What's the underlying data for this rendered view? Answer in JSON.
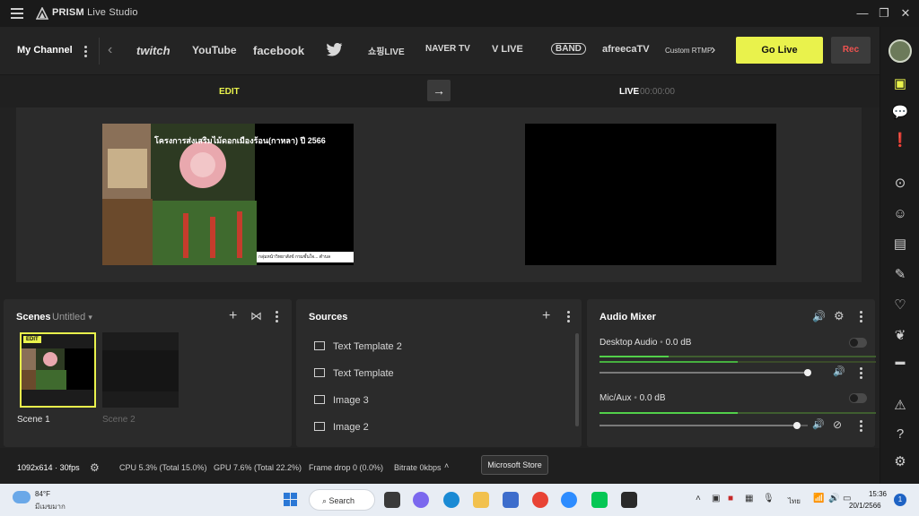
{
  "titlebar": {
    "app_name": "PRISM",
    "app_subtitle": "Live Studio",
    "minimize": "—",
    "restore": "❐",
    "close": "✕"
  },
  "channelbar": {
    "channel_label": "My Channel",
    "platforms": [
      "twitch",
      "YouTube",
      "facebook",
      "twitter",
      "쇼핑LIVE",
      "NAVER TV",
      "V LIVE",
      "BAND",
      "afreecaTV",
      "Custom RTMP"
    ],
    "go_live": "Go Live",
    "rec": "Rec"
  },
  "modebar": {
    "edit": "EDIT",
    "live": "LIVE",
    "live_timer": "00:00:00"
  },
  "preview": {
    "title": "โครงการส่งเสริมไม้ดอกเมืองร้อน(กาหลา) ปี 2566",
    "caption": "กลุ่มหน้าวิทยาสังข์ กรมชั้นใจ... ตำบล"
  },
  "scenes": {
    "title": "Scenes",
    "collection": "Untitled",
    "badge": "EDIT",
    "items": [
      "Scene 1",
      "Scene 2"
    ]
  },
  "sources": {
    "title": "Sources",
    "items": [
      "Text Template 2",
      "Text Template",
      "Image 3",
      "Image 2"
    ]
  },
  "audio": {
    "title": "Audio Mixer",
    "channels": [
      {
        "label": "Desktop Audio",
        "level": "0.0 dB",
        "meter": 0.25,
        "volume": 1.0
      },
      {
        "label": "Mic/Aux",
        "level": "0.0 dB",
        "meter": 0.5,
        "volume": 0.95
      }
    ]
  },
  "status": {
    "resolution": "1092x614",
    "fps": "30fps",
    "cpu": "CPU 5.3% (Total 15.0%)",
    "gpu": "GPU 7.6% (Total 22.2%)",
    "frame_drop": "Frame drop 0 (0.0%)",
    "bitrate": "Bitrate 0kbps",
    "tooltip": "Microsoft Store"
  },
  "taskbar": {
    "temperature": "84°F",
    "weather": "มีเมฆมาก",
    "search_label": "Search",
    "language": "ไทย",
    "time": "15:36",
    "date": "20/1/2566",
    "notification_count": "1"
  },
  "colors": {
    "accent": "#e9f24c",
    "rec_text": "#ef5350",
    "meter_green": "#52d04a"
  }
}
